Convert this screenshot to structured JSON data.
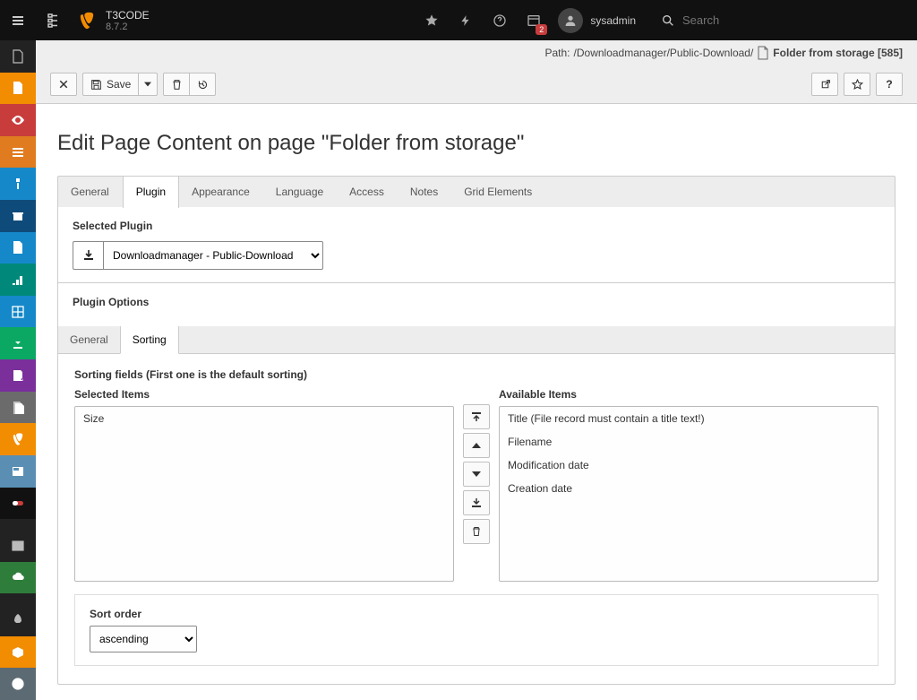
{
  "brand": {
    "title": "T3CODE",
    "version": "8.7.2"
  },
  "topbar": {
    "user": "sysadmin",
    "search_placeholder": "Search",
    "notifications_badge": "2"
  },
  "path": {
    "prefix": "Path:",
    "segments": "/Downloadmanager/Public-Download/",
    "page": "Folder from storage [585]"
  },
  "toolbar": {
    "save_label": "Save"
  },
  "heading": "Edit Page Content on page \"Folder from storage\"",
  "tabs": {
    "main": [
      "General",
      "Plugin",
      "Appearance",
      "Language",
      "Access",
      "Notes",
      "Grid Elements"
    ],
    "main_active_index": 1,
    "sub": [
      "General",
      "Sorting"
    ],
    "sub_active_index": 1
  },
  "selected_plugin": {
    "label": "Selected Plugin",
    "options": [
      "Downloadmanager - Public-Download"
    ],
    "value": "Downloadmanager - Public-Download"
  },
  "plugin_options_label": "Plugin Options",
  "sorting": {
    "section_label": "Sorting fields (First one is the default sorting)",
    "selected_label": "Selected Items",
    "available_label": "Available Items",
    "selected": [
      "Size"
    ],
    "available": [
      "Title (File record must contain a title text!)",
      "Filename",
      "Modification date",
      "Creation date"
    ]
  },
  "sort_order": {
    "label": "Sort order",
    "options": [
      "ascending"
    ],
    "value": "ascending"
  }
}
